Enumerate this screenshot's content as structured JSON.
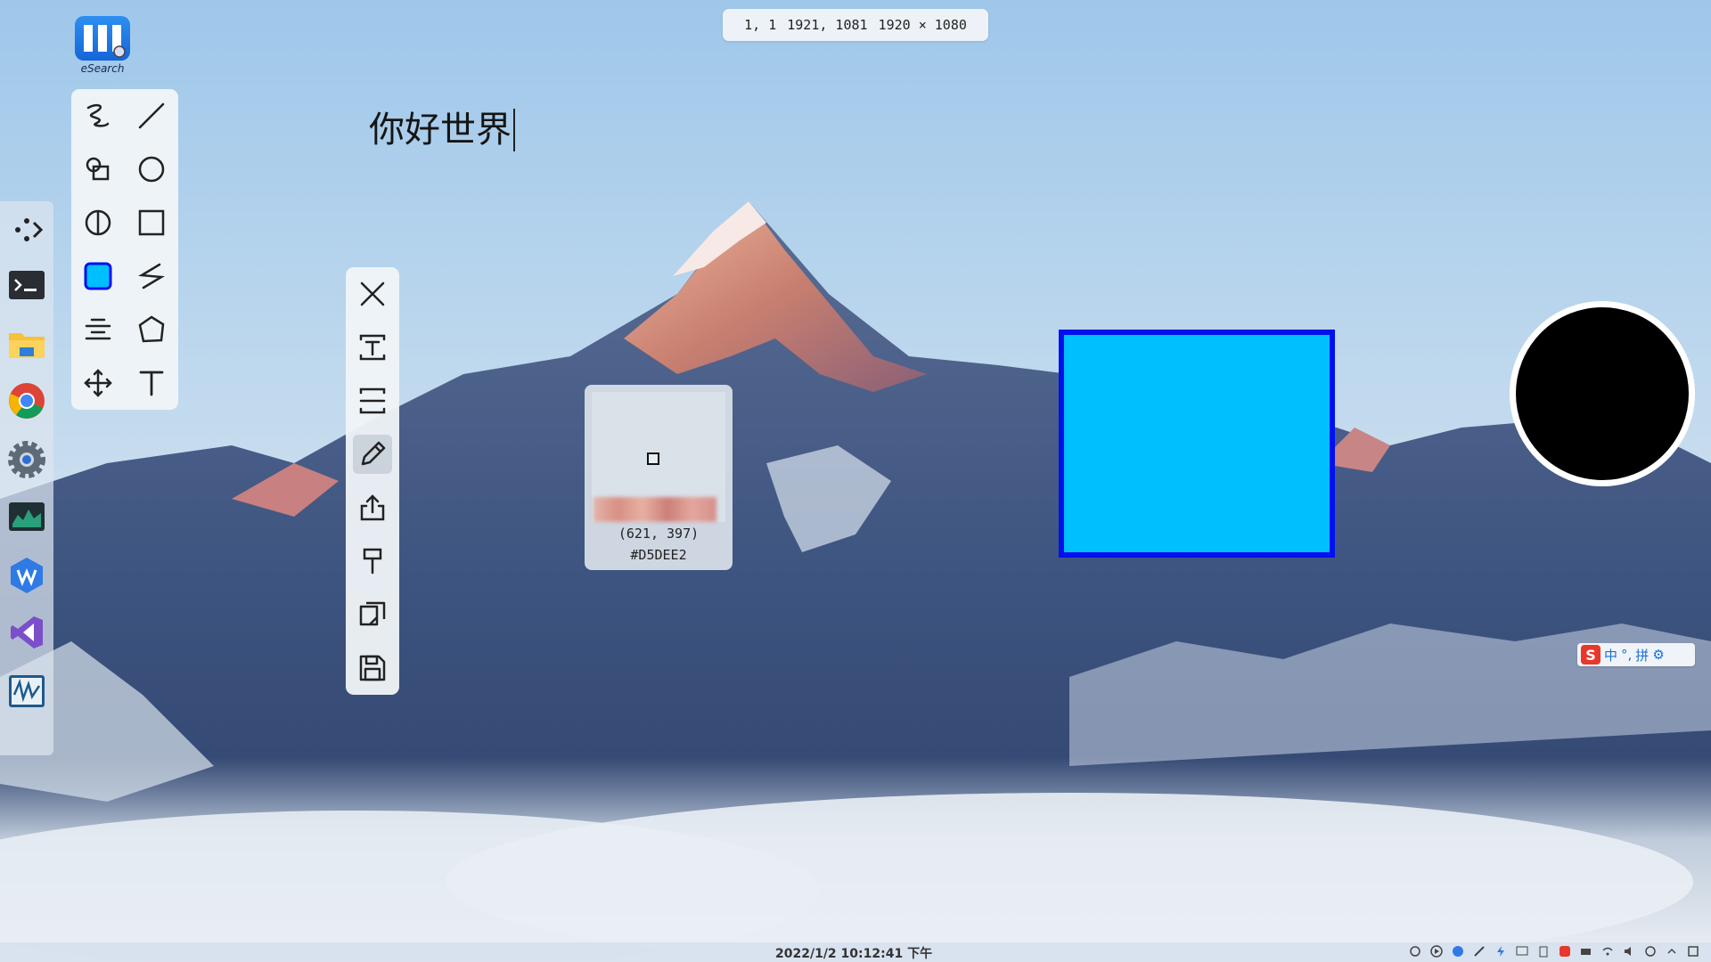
{
  "coord_bar": {
    "start": "1, 1",
    "end": "1921, 1081",
    "size": "1920 × 1080"
  },
  "desktop_icon": {
    "label": "eSearch",
    "icon": "esearch-app-icon"
  },
  "dock": {
    "items": [
      {
        "icon": "dots-arrow-icon"
      },
      {
        "icon": "terminal-icon"
      },
      {
        "icon": "file-explorer-icon"
      },
      {
        "icon": "chrome-icon"
      },
      {
        "icon": "settings-gear-icon"
      },
      {
        "icon": "system-monitor-icon"
      },
      {
        "icon": "wps-icon"
      },
      {
        "icon": "visual-studio-icon"
      },
      {
        "icon": "waveform-app-icon"
      }
    ]
  },
  "draw_tools": {
    "items": [
      {
        "icon": "freehand-pen-icon"
      },
      {
        "icon": "line-icon"
      },
      {
        "icon": "shapes-icon"
      },
      {
        "icon": "circle-icon"
      },
      {
        "icon": "half-circle-fill-icon"
      },
      {
        "icon": "rectangle-icon"
      },
      {
        "icon": "fill-color-swatch-icon",
        "color": "#00bfff"
      },
      {
        "icon": "polyline-icon"
      },
      {
        "icon": "align-center-icon"
      },
      {
        "icon": "polygon-icon"
      },
      {
        "icon": "move-icon"
      },
      {
        "icon": "text-icon"
      }
    ]
  },
  "action_bar": {
    "items": [
      {
        "icon": "close-icon"
      },
      {
        "icon": "ocr-text-icon"
      },
      {
        "icon": "scroll-capture-icon"
      },
      {
        "icon": "pencil-edit-icon",
        "active": true
      },
      {
        "icon": "share-icon"
      },
      {
        "icon": "pin-icon"
      },
      {
        "icon": "copy-icon"
      },
      {
        "icon": "save-icon"
      }
    ]
  },
  "canvas": {
    "text": "你好世界",
    "rect_fill": "#00bfff",
    "rect_border": "#0010ee",
    "circle_fill": "#000000",
    "circle_border": "#ffffff"
  },
  "magnifier": {
    "coord": "(621, 397)",
    "hex": "#D5DEE2"
  },
  "ime": {
    "logo": "S",
    "items": [
      "中",
      "°,",
      "拼",
      "⚙"
    ]
  },
  "taskbar": {
    "clock": "2022/1/2  10:12:41 下午",
    "tray_icons": [
      "network-icon",
      "media-icon",
      "browser-icon",
      "pen-icon",
      "flash-icon",
      "display-icon",
      "clipboard-icon",
      "sogou-icon",
      "battery-icon",
      "wifi-icon",
      "volume-icon",
      "update-icon",
      "chevron-up-icon",
      "notification-icon"
    ]
  }
}
